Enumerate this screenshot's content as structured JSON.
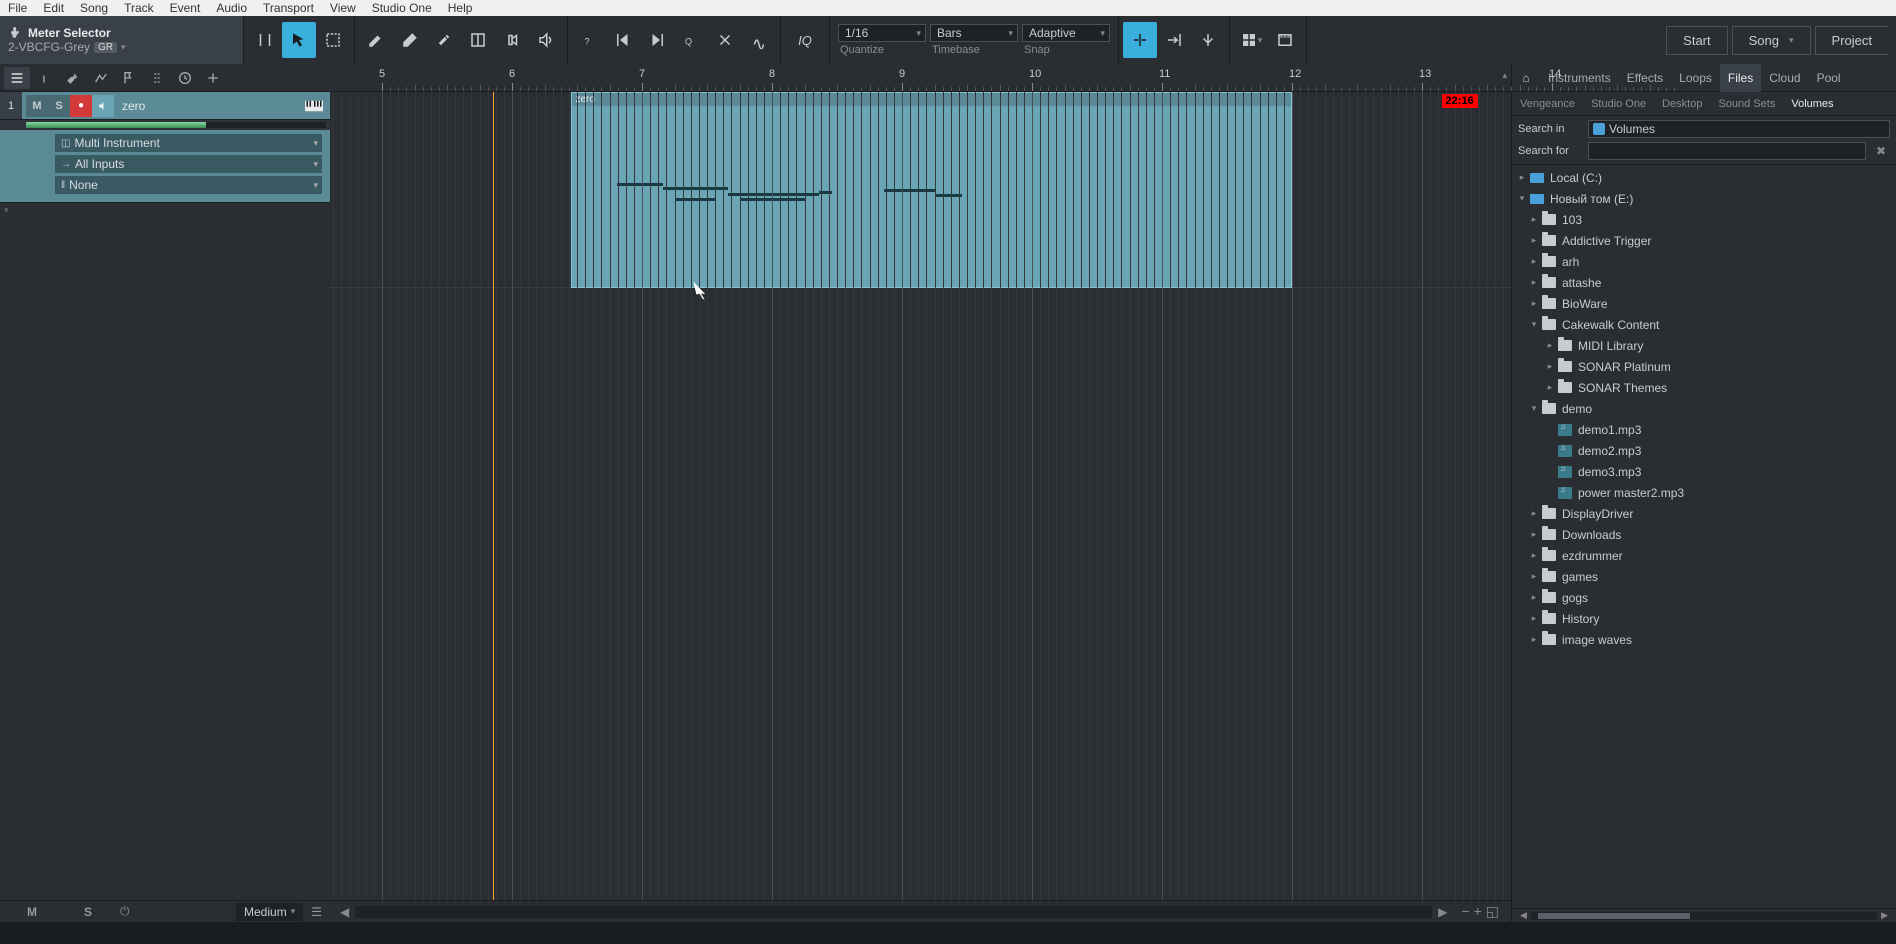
{
  "menu": [
    "File",
    "Edit",
    "Song",
    "Track",
    "Event",
    "Audio",
    "Transport",
    "View",
    "Studio One",
    "Help"
  ],
  "meter_selector": {
    "title": "Meter Selector",
    "sub": "2-VBCFG-Grey",
    "badge": "GR"
  },
  "quantize": {
    "value": "1/16",
    "label": "Quantize"
  },
  "timebase": {
    "value": "Bars",
    "label": "Timebase"
  },
  "snap": {
    "value": "Adaptive",
    "label": "Snap"
  },
  "right_buttons": {
    "start": "Start",
    "song": "Song",
    "project": "Project"
  },
  "track": {
    "number": "1",
    "mute": "M",
    "solo": "S",
    "name": "zero",
    "instrument": "Multi Instrument",
    "input": "All Inputs",
    "output": "None",
    "size": "Medium"
  },
  "global": {
    "m": "M",
    "s": "S"
  },
  "ruler": {
    "bars": [
      5,
      6,
      7,
      8,
      9,
      10,
      11,
      12,
      13
    ],
    "marker": "22:16"
  },
  "clip": {
    "name": "zero"
  },
  "browser": {
    "tabs": [
      "Instruments",
      "Effects",
      "Loops",
      "Files",
      "Cloud",
      "Pool"
    ],
    "active_tab": 3,
    "subtabs": [
      "Vengeance",
      "Studio One",
      "Desktop",
      "Sound Sets",
      "Volumes"
    ],
    "active_subtab": 4,
    "search_in_label": "Search in",
    "search_in_value": "Volumes",
    "search_for_label": "Search for",
    "search_for_value": "",
    "tree": [
      {
        "depth": 0,
        "type": "drive",
        "expand": "closed",
        "label": "Local (C:)"
      },
      {
        "depth": 0,
        "type": "drive",
        "expand": "open",
        "label": "Новый том (E:)"
      },
      {
        "depth": 1,
        "type": "folder",
        "expand": "closed",
        "label": "103"
      },
      {
        "depth": 1,
        "type": "folder",
        "expand": "closed",
        "label": "Addictive Trigger"
      },
      {
        "depth": 1,
        "type": "folder",
        "expand": "closed",
        "label": "arh"
      },
      {
        "depth": 1,
        "type": "folder",
        "expand": "closed",
        "label": "attashe"
      },
      {
        "depth": 1,
        "type": "folder",
        "expand": "closed",
        "label": "BioWare"
      },
      {
        "depth": 1,
        "type": "folder",
        "expand": "open",
        "label": "Cakewalk Content"
      },
      {
        "depth": 2,
        "type": "folder",
        "expand": "closed",
        "label": "MIDI Library"
      },
      {
        "depth": 2,
        "type": "folder",
        "expand": "closed",
        "label": "SONAR Platinum"
      },
      {
        "depth": 2,
        "type": "folder",
        "expand": "closed",
        "label": "SONAR Themes"
      },
      {
        "depth": 1,
        "type": "folder",
        "expand": "open",
        "label": "demo"
      },
      {
        "depth": 2,
        "type": "audio",
        "expand": "none",
        "label": "demo1.mp3"
      },
      {
        "depth": 2,
        "type": "audio",
        "expand": "none",
        "label": "demo2.mp3"
      },
      {
        "depth": 2,
        "type": "audio",
        "expand": "none",
        "label": "demo3.mp3"
      },
      {
        "depth": 2,
        "type": "audio",
        "expand": "none",
        "label": "power master2.mp3"
      },
      {
        "depth": 1,
        "type": "folder",
        "expand": "closed",
        "label": "DisplayDriver"
      },
      {
        "depth": 1,
        "type": "folder",
        "expand": "closed",
        "label": "Downloads"
      },
      {
        "depth": 1,
        "type": "folder",
        "expand": "closed",
        "label": "ezdrummer"
      },
      {
        "depth": 1,
        "type": "folder",
        "expand": "closed",
        "label": "games"
      },
      {
        "depth": 1,
        "type": "folder",
        "expand": "closed",
        "label": "gogs"
      },
      {
        "depth": 1,
        "type": "folder",
        "expand": "closed",
        "label": "History"
      },
      {
        "depth": 1,
        "type": "folder",
        "expand": "closed",
        "label": "image waves"
      }
    ]
  }
}
